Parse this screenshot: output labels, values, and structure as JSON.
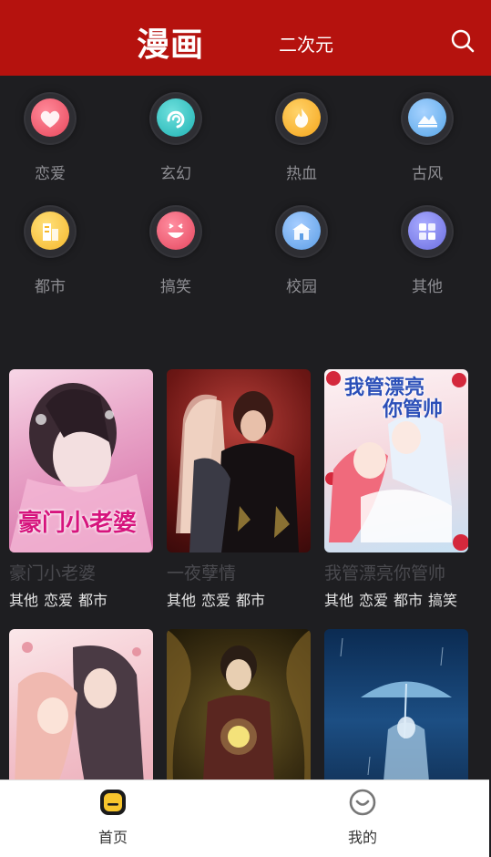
{
  "header": {
    "tab_main": "漫画",
    "tab_secondary": "二次元"
  },
  "categories": [
    {
      "label": "恋爱",
      "icon": "heart-icon",
      "color": "#e8475b"
    },
    {
      "label": "玄幻",
      "icon": "swirl-icon",
      "color": "#1fb3b4"
    },
    {
      "label": "热血",
      "icon": "flame-icon",
      "color": "#f5a51b"
    },
    {
      "label": "古风",
      "icon": "landscape-icon",
      "color": "#58a6e8"
    },
    {
      "label": "都市",
      "icon": "building-icon",
      "color": "#f5b82c"
    },
    {
      "label": "搞笑",
      "icon": "laugh-face-icon",
      "color": "#e5465e"
    },
    {
      "label": "校园",
      "icon": "school-icon",
      "color": "#5c9ee6"
    },
    {
      "label": "其他",
      "icon": "grid-icon",
      "color": "#6b6ee0"
    }
  ],
  "comics": [
    {
      "title": "豪门小老婆",
      "tags": [
        "其他",
        "恋爱",
        "都市"
      ],
      "cover_text": "豪门小老婆"
    },
    {
      "title": "一夜孽情",
      "tags": [
        "其他",
        "恋爱",
        "都市"
      ],
      "cover_text": ""
    },
    {
      "title": "我管漂亮你管帅",
      "tags": [
        "其他",
        "恋爱",
        "都市",
        "搞笑"
      ],
      "cover_text_1": "我管漂亮",
      "cover_text_2": "你管帅"
    },
    {
      "title": "",
      "tags": [],
      "cover_text": ""
    },
    {
      "title": "",
      "tags": [],
      "cover_text": ""
    },
    {
      "title": "",
      "tags": [],
      "cover_text": ""
    }
  ],
  "bottom_nav": {
    "home": "首页",
    "mine": "我的"
  },
  "colors": {
    "header_bg": "#b5120e",
    "page_bg": "#1e1e21",
    "home_icon": "#f7c52d"
  }
}
